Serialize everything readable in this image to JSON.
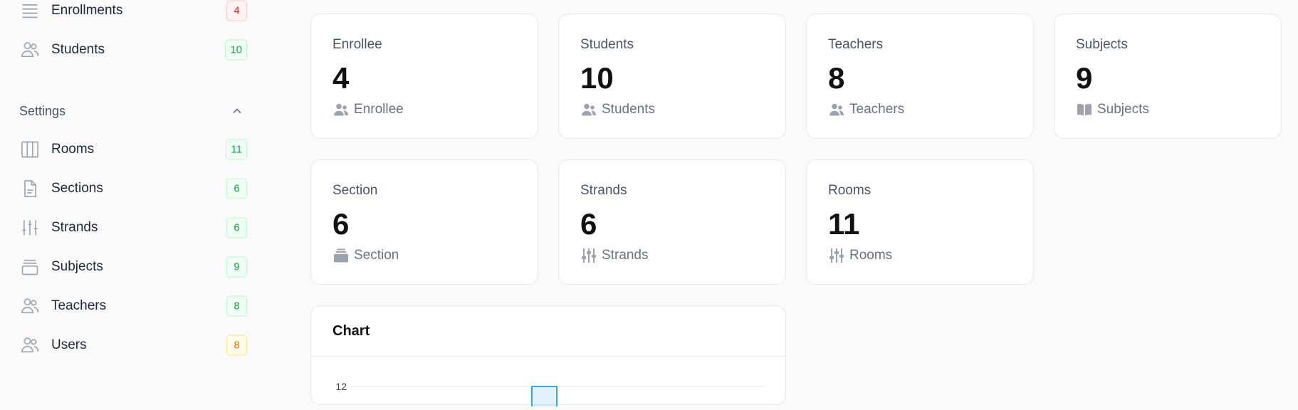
{
  "sidebar": {
    "items": [
      {
        "label": "Enrollments",
        "icon": "list-icon",
        "badge": "4",
        "badge_color": "red"
      },
      {
        "label": "Students",
        "icon": "users-icon",
        "badge": "10",
        "badge_color": "green"
      }
    ],
    "settings": {
      "title": "Settings",
      "items": [
        {
          "label": "Rooms",
          "icon": "columns-icon",
          "badge": "11",
          "badge_color": "green"
        },
        {
          "label": "Sections",
          "icon": "document-icon",
          "badge": "6",
          "badge_color": "green"
        },
        {
          "label": "Strands",
          "icon": "sliders-icon",
          "badge": "6",
          "badge_color": "green"
        },
        {
          "label": "Subjects",
          "icon": "archive-icon",
          "badge": "9",
          "badge_color": "green"
        },
        {
          "label": "Teachers",
          "icon": "users-icon",
          "badge": "8",
          "badge_color": "green"
        },
        {
          "label": "Users",
          "icon": "users-icon",
          "badge": "8",
          "badge_color": "amber"
        }
      ]
    }
  },
  "cards": [
    {
      "title": "Enrollee",
      "value": "4",
      "foot": "Enrollee",
      "icon": "users-solid-icon"
    },
    {
      "title": "Students",
      "value": "10",
      "foot": "Students",
      "icon": "users-solid-icon"
    },
    {
      "title": "Teachers",
      "value": "8",
      "foot": "Teachers",
      "icon": "users-solid-icon"
    },
    {
      "title": "Subjects",
      "value": "9",
      "foot": "Subjects",
      "icon": "book-icon"
    },
    {
      "title": "Section",
      "value": "6",
      "foot": "Section",
      "icon": "inbox-stack-icon"
    },
    {
      "title": "Strands",
      "value": "6",
      "foot": "Strands",
      "icon": "sliders-icon"
    },
    {
      "title": "Rooms",
      "value": "11",
      "foot": "Rooms",
      "icon": "sliders-icon"
    }
  ],
  "chart": {
    "title": "Chart"
  },
  "chart_data": {
    "type": "bar",
    "title": "Chart",
    "yticks": [
      "12"
    ],
    "ylim": [
      0,
      12
    ],
    "series_color": "#38a9e8"
  },
  "colors": {
    "accent": "#38a9e8",
    "badge_red": "#dc2626",
    "badge_green": "#16a34a",
    "badge_amber": "#d97706"
  }
}
